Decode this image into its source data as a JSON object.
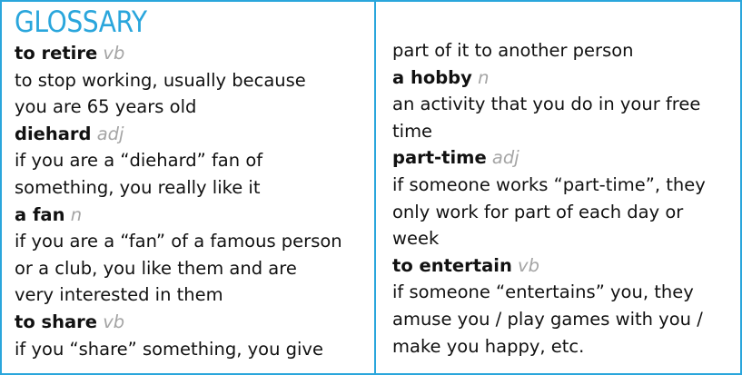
{
  "title": "GLOSSARY",
  "left": {
    "e1": {
      "term": "to retire",
      "pos": "vb",
      "def": [
        "to stop working, usually because",
        "you are 65 years old"
      ]
    },
    "e2": {
      "term": "diehard",
      "pos": "adj",
      "def": [
        "if you are a “diehard” fan of",
        "something, you really like it"
      ]
    },
    "e3": {
      "term": "a fan",
      "pos": "n",
      "def": [
        "if you are a “fan” of a famous person",
        "or a club, you like them and are",
        "very interested in them"
      ]
    },
    "e4": {
      "term": "to share",
      "pos": "vb",
      "def": [
        "if you “share” something, you give"
      ]
    }
  },
  "right": {
    "cont": [
      "part of it to another person"
    ],
    "e5": {
      "term": "a hobby",
      "pos": "n",
      "def": [
        "an activity that you do in your free",
        "time"
      ]
    },
    "e6": {
      "term": "part-time",
      "pos": "adj",
      "def": [
        "if someone works “part-time”, they",
        "only work for part of each day or",
        "week"
      ]
    },
    "e7": {
      "term": "to entertain",
      "pos": "vb",
      "def": [
        "if someone “entertains” you, they",
        "amuse you / play games with you /",
        "make you happy, etc."
      ]
    }
  }
}
